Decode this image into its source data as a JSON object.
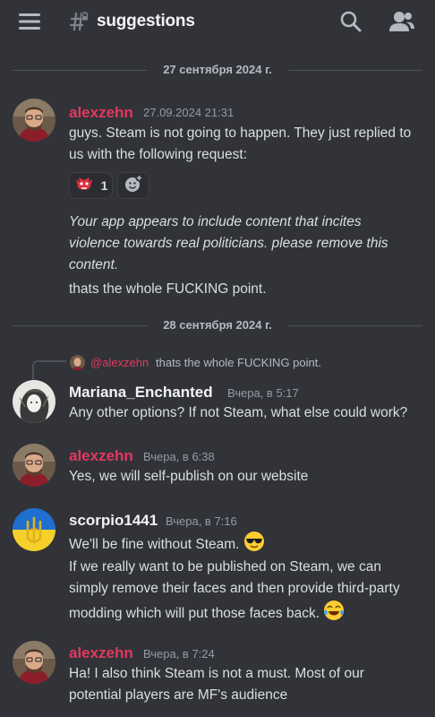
{
  "header": {
    "channel_name": "suggestions",
    "icons": [
      "hamburger-menu-icon",
      "text-channel-hash-icon",
      "search-icon",
      "members-icon"
    ]
  },
  "dividers": [
    "27 сентября 2024 г.",
    "28 сентября 2024 г."
  ],
  "messages": [
    {
      "author": "alexzehn",
      "time": "27.09.2024 21:31",
      "lines": [
        "guys. Steam is not going to happen. They just replied to",
        "us with the following request:"
      ],
      "reactions": [
        {
          "emoji": "goblin-face",
          "count": "1"
        },
        {
          "emoji": "add-reaction",
          "count": ""
        }
      ],
      "quote": [
        "Your app appears to include content that incites",
        "violence towards real politicians. please remove this",
        "content."
      ],
      "after": "thats the whole FUCKING point."
    },
    {
      "reply_to": "@alexzehn",
      "reply_text": "thats the whole FUCKING point.",
      "author": "Mariana_Enchanted",
      "time": "Вчера, в 5:17",
      "text": "Any other options? If not Steam, what else could work?"
    },
    {
      "author": "alexzehn",
      "time": "Вчера, в 6:38",
      "text": "Yes, we will self-publish on our website"
    },
    {
      "author": "scorpio1441",
      "time": "Вчера, в 7:16",
      "text": "We'll be fine without Steam.",
      "lines": [
        "If we really want to be published on Steam, we can",
        "simply remove their faces and then provide third-party",
        "modding which will put those faces back."
      ]
    },
    {
      "author": "alexzehn",
      "time": "Вчера, в 7:24",
      "lines": [
        "Ha! I also think Steam is not a must. Most of our",
        "potential players are MF's audience"
      ]
    }
  ],
  "colors": {
    "background": "#313338",
    "username_red": "#e3385f",
    "text": "#dbdee1",
    "muted": "#949ba4"
  }
}
